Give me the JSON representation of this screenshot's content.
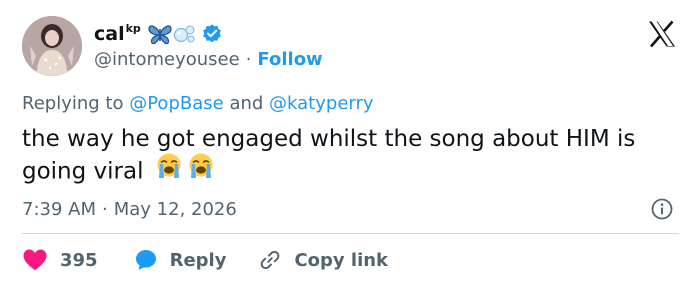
{
  "author": {
    "display_name": "cal",
    "display_name_sup": "kp",
    "name_emojis": [
      "butterfly-emoji",
      "bubbles-emoji"
    ],
    "verified": true,
    "handle": "@intomeyousee",
    "separator": "·",
    "follow_label": "Follow"
  },
  "reply_context": {
    "prefix": "Replying to",
    "mention_1": "@PopBase",
    "conjunction": "and",
    "mention_2": "@katyperry"
  },
  "tweet": {
    "text": "the way he got engaged whilst the song about HIM is going viral",
    "emojis": [
      "loudly-crying-face-emoji",
      "loudly-crying-face-emoji"
    ]
  },
  "meta": {
    "time": "7:39 AM",
    "separator": "·",
    "date": "May 12, 2026"
  },
  "actions": {
    "like_count": "395",
    "reply_label": "Reply",
    "copy_link_label": "Copy link"
  },
  "colors": {
    "accent": "#1d9bf0",
    "secondary_text": "#536471",
    "heart": "#f91880",
    "divider": "#cfd9de"
  },
  "icons": {
    "brand": "x-logo-icon",
    "info": "info-icon",
    "like": "heart-icon",
    "reply": "speech-bubble-icon",
    "copy": "link-icon"
  }
}
